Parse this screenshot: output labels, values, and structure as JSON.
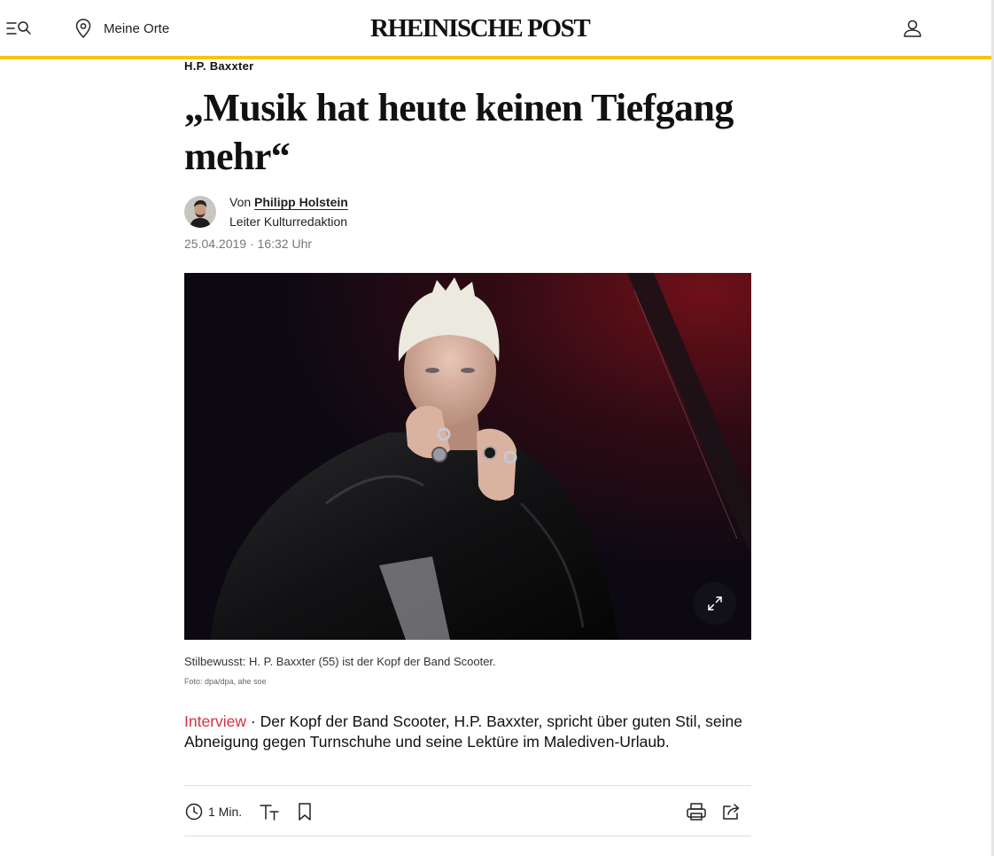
{
  "header": {
    "brand": "RHEINISCHE POST",
    "places_label": "Meine Orte",
    "icons": [
      "menu-search-icon",
      "map-pin-icon",
      "user-icon"
    ],
    "accent_color": "#f5c800"
  },
  "article": {
    "kicker": "H.P. Baxxter",
    "headline": "„Musik hat heute keinen Tiefgang mehr“",
    "author_prefix": "Von",
    "author_name": "Philipp Holstein",
    "author_role": "Leiter Kulturredaktion",
    "date": "25.04.2019",
    "date_separator": "·",
    "time": "16:32 Uhr",
    "image_caption": "Stilbewusst: H. P. Baxxter (55) ist der Kopf der Band Scooter.",
    "image_credit": "Foto: dpa/dpa, ahe soe",
    "teaser_tag": "Interview",
    "teaser_separator": " · ",
    "teaser_text": "Der Kopf der Band Scooter, H.P. Baxxter, spricht über guten Stil, seine Abneigung gegen Turnschuhe und seine Lektüre im Malediven-Urlaub.",
    "tag_color": "#d8303f"
  },
  "toolbar": {
    "reading_time": "1 Min.",
    "icons": [
      "clock-icon",
      "font-size-icon",
      "bookmark-icon",
      "print-icon",
      "share-icon"
    ]
  }
}
